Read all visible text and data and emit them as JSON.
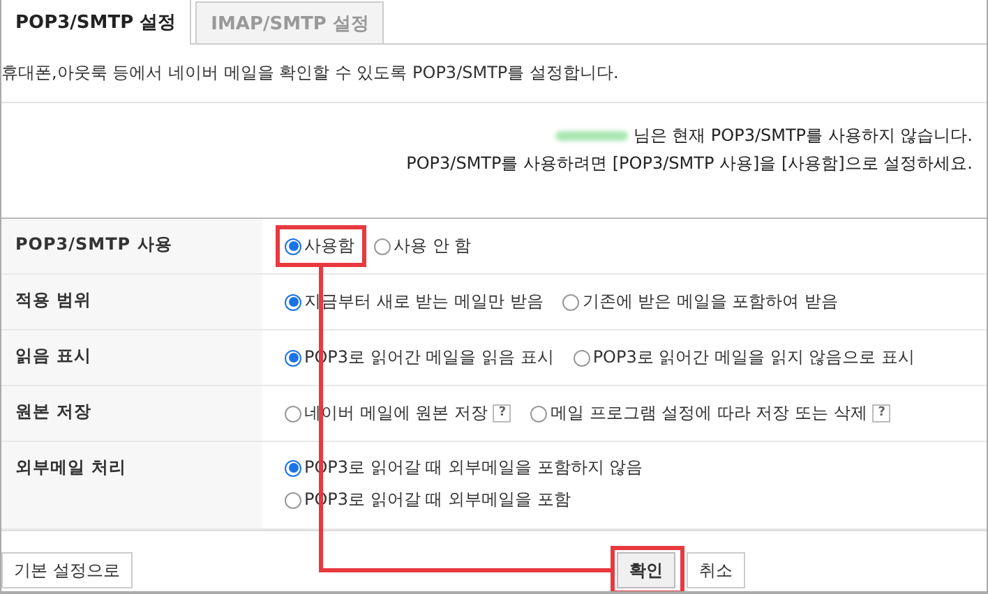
{
  "tabs": [
    {
      "label": "POP3/SMTP 설정",
      "selected": true
    },
    {
      "label": "IMAP/SMTP 설정",
      "selected": false
    }
  ],
  "description": "휴대폰,아웃룩 등에서 네이버 메일을 확인할 수 있도록 POP3/SMTP를 설정합니다.",
  "status": {
    "name_redacted": true,
    "lines": [
      "님은 현재 POP3/SMTP를 사용하지 않습니다.",
      "POP3/SMTP를 사용하려면 [POP3/SMTP 사용]을 [사용함]으로 설정하세요."
    ]
  },
  "settings": [
    {
      "label": "POP3/SMTP 사용",
      "kind": "inline",
      "options": [
        {
          "label": "사용함",
          "selected": true,
          "highlighted": true
        },
        {
          "label": "사용 안 함",
          "selected": false,
          "highlighted": false
        }
      ]
    },
    {
      "label": "적용 범위",
      "kind": "inline",
      "options": [
        {
          "label": "지금부터 새로 받는 메일만 받음",
          "selected": true,
          "highlighted": false
        },
        {
          "label": "기존에 받은 메일을 포함하여 받음",
          "selected": false,
          "highlighted": false
        }
      ]
    },
    {
      "label": "읽음 표시",
      "kind": "inline",
      "options": [
        {
          "label": "POP3로 읽어간 메일을 읽음 표시",
          "selected": true,
          "highlighted": false
        },
        {
          "label": "POP3로 읽어간 메일을 읽지 않음으로 표시",
          "selected": false,
          "highlighted": false
        }
      ]
    },
    {
      "label": "원본 저장",
      "kind": "inline",
      "options": [
        {
          "label": "네이버 메일에 원본 저장",
          "selected": false,
          "highlighted": false,
          "help": "?"
        },
        {
          "label": "메일 프로그램 설정에 따라 저장 또는 삭제",
          "selected": false,
          "highlighted": false,
          "help": "?"
        }
      ]
    },
    {
      "label": "외부메일 처리",
      "kind": "stacked",
      "options": [
        {
          "label": "POP3로 읽어갈 때 외부메일을 포함하지 않음",
          "selected": true,
          "highlighted": false
        },
        {
          "label": "POP3로 읽어갈 때 외부메일을 포함",
          "selected": false,
          "highlighted": false
        }
      ]
    }
  ],
  "buttons": {
    "left": [
      {
        "label": "기본 설정으로",
        "kind": "secondary",
        "highlighted": false
      }
    ],
    "right": [
      {
        "label": "확인",
        "kind": "primary",
        "highlighted": true
      },
      {
        "label": "취소",
        "kind": "secondary",
        "highlighted": false
      }
    ]
  }
}
